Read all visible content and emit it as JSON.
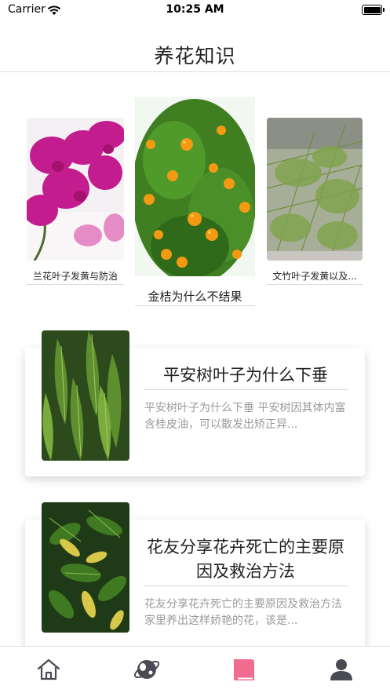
{
  "status_bar": {
    "carrier": "Carrier",
    "time": "10:25 AM"
  },
  "nav": {
    "title": "养花知识"
  },
  "carousel": {
    "items": [
      {
        "caption": "兰花叶子发黄与防治",
        "image": "orchid-photo"
      },
      {
        "caption": "金桔为什么不结果",
        "image": "kumquat-photo"
      },
      {
        "caption": "文竹叶子发黄以及...",
        "image": "asparagus-fern-photo"
      }
    ]
  },
  "articles": [
    {
      "title": "平安树叶子为什么下垂",
      "description": "平安树叶子为什么下垂 平安树因其体内富含桂皮油，可以散发出矫正异...",
      "image": "cinnamon-tree-photo"
    },
    {
      "title": "花友分享花卉死亡的主要原因及救治方法",
      "description": "花友分享花卉死亡的主要原因及救治方法 家里养出这样娇艳的花，该是...",
      "image": "schefflera-photo"
    }
  ],
  "tab_bar": {
    "tabs": [
      {
        "icon": "home-icon",
        "active": false
      },
      {
        "icon": "planet-icon",
        "active": false
      },
      {
        "icon": "book-icon",
        "active": true
      },
      {
        "icon": "profile-icon",
        "active": false
      }
    ],
    "active_color": "#f06b8d",
    "inactive_color": "#4a4a55"
  }
}
